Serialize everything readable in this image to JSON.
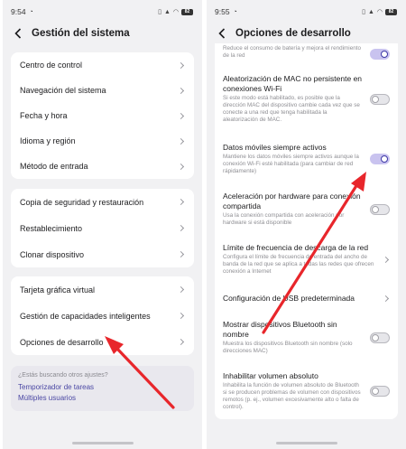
{
  "left": {
    "time": "9:54",
    "battery": "82",
    "title": "Gestión del sistema",
    "group1": [
      "Centro de control",
      "Navegación del sistema",
      "Fecha y hora",
      "Idioma y región",
      "Método de entrada"
    ],
    "group2": [
      "Copia de seguridad y restauración",
      "Restablecimiento",
      "Clonar dispositivo"
    ],
    "group3": [
      "Tarjeta gráfica virtual",
      "Gestión de capacidades inteligentes",
      "Opciones de desarrollo"
    ],
    "suggestion": {
      "question": "¿Estás buscando otros ajustes?",
      "links": [
        "Temporizador de tareas",
        "Múltiples usuarios"
      ]
    }
  },
  "right": {
    "time": "9:55",
    "battery": "82",
    "title": "Opciones de desarrollo",
    "items": [
      {
        "title": "",
        "desc": "Reduce el consumo de batería y mejora el rendimiento de la red",
        "control": "toggle",
        "on": true
      },
      {
        "title": "Aleatorización de MAC no persistente en conexiones Wi-Fi",
        "desc": "Si este modo está habilitado, es posible que la dirección MAC del dispositivo cambie cada vez que se conecte a una red que tenga habilitada la aleatorización de MAC.",
        "control": "toggle",
        "on": false
      },
      {
        "title": "Datos móviles siempre activos",
        "desc": "Mantiene los datos móviles siempre activos aunque la conexión Wi-Fi esté habilitada (para cambiar de red rápidamente)",
        "control": "toggle",
        "on": true
      },
      {
        "title": "Aceleración por hardware para conexión compartida",
        "desc": "Usa la conexión compartida con aceleración por hardware si está disponible",
        "control": "toggle",
        "on": false
      },
      {
        "title": "Límite de frecuencia de descarga de la red",
        "desc": "Configura el límite de frecuencia de entrada del ancho de banda de la red que se aplica a todas las redes que ofrecen conexión a Internet",
        "control": "chevron"
      },
      {
        "title": "Configuración de USB predeterminada",
        "desc": "",
        "control": "chevron"
      },
      {
        "title": "Mostrar dispositivos Bluetooth sin nombre",
        "desc": "Muestra los dispositivos Bluetooth sin nombre (solo direcciones MAC)",
        "control": "toggle",
        "on": false
      },
      {
        "title": "Inhabilitar volumen absoluto",
        "desc": "Inhabilita la función de volumen absoluto de Bluetooth si se producen problemas de volumen con dispositivos remotos (p. ej., volumen excesivamente alto o falta de control).",
        "control": "toggle",
        "on": false
      }
    ]
  },
  "colors": {
    "accent": "#3d38a6",
    "toggle_on_track": "#c9c3ef",
    "annotation_arrow": "#e8262b",
    "background": "#f1f1f3"
  }
}
